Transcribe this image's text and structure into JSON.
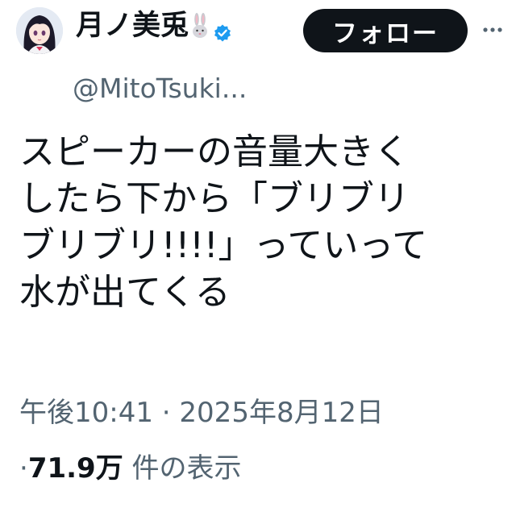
{
  "header": {
    "display_name": "月ノ美兎",
    "name_emoji": "🐰",
    "handle": "@MitoTsuki...",
    "follow_label": "フォロー",
    "more_label": "···",
    "verified_color": "#1d9bf0"
  },
  "tweet": {
    "lines": [
      "スピーカーの音量大きく",
      "したら下から「ブリブリ",
      "ブリブリ!!!!」っていって",
      "水が出てくる"
    ]
  },
  "meta": {
    "time": "午後10:41",
    "separator": " · ",
    "date": "2025年8月12日",
    "views_prefix": "·",
    "views_count": "71.9万",
    "views_suffix": " 件の表示"
  },
  "colors": {
    "text_primary": "#0f1419",
    "text_secondary": "#536471",
    "button_bg": "#0f1419",
    "button_text": "#ffffff"
  }
}
